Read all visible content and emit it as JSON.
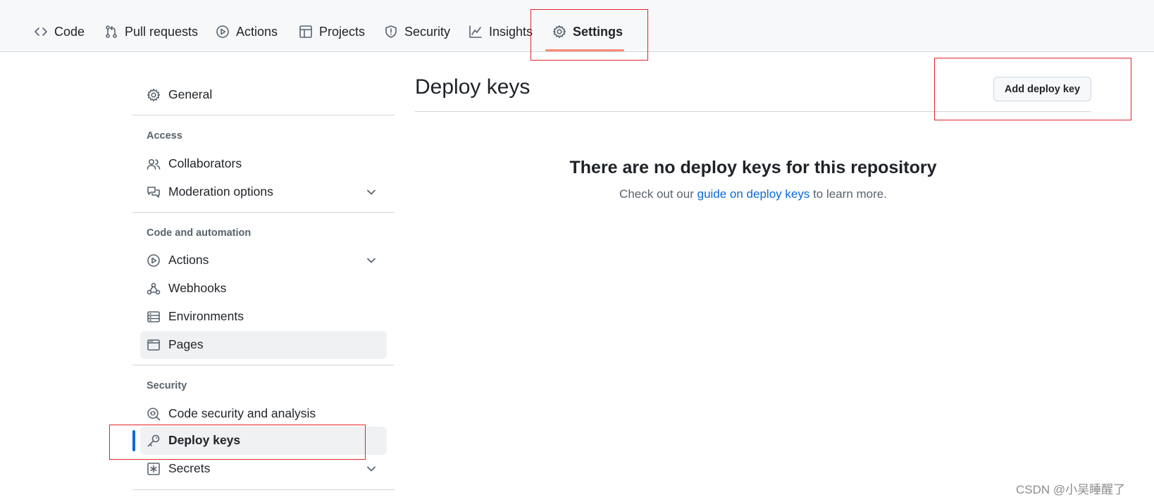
{
  "repo_nav": {
    "tabs": [
      {
        "label": "Code",
        "icon": "code-icon"
      },
      {
        "label": "Pull requests",
        "icon": "pull-request-icon"
      },
      {
        "label": "Actions",
        "icon": "play-icon"
      },
      {
        "label": "Projects",
        "icon": "table-icon"
      },
      {
        "label": "Security",
        "icon": "shield-icon"
      },
      {
        "label": "Insights",
        "icon": "graph-icon"
      },
      {
        "label": "Settings",
        "icon": "gear-icon",
        "selected": true
      }
    ]
  },
  "sidebar": {
    "general": "General",
    "headings": {
      "access": "Access",
      "code_automation": "Code and automation",
      "security": "Security"
    },
    "items": {
      "collaborators": "Collaborators",
      "moderation": "Moderation options",
      "actions": "Actions",
      "webhooks": "Webhooks",
      "environments": "Environments",
      "pages": "Pages",
      "code_security": "Code security and analysis",
      "deploy_keys": "Deploy keys",
      "secrets": "Secrets"
    }
  },
  "main": {
    "title": "Deploy keys",
    "add_button": "Add deploy key",
    "blankslate": {
      "heading": "There are no deploy keys for this repository",
      "desc_before": "Check out our ",
      "desc_link": "guide on deploy keys",
      "desc_after": " to learn more."
    }
  },
  "watermark": "CSDN @小吴睡醒了",
  "colors": {
    "accent": "#0969da",
    "tab_underline": "#fd8c73",
    "annotation": "#e3242b"
  }
}
